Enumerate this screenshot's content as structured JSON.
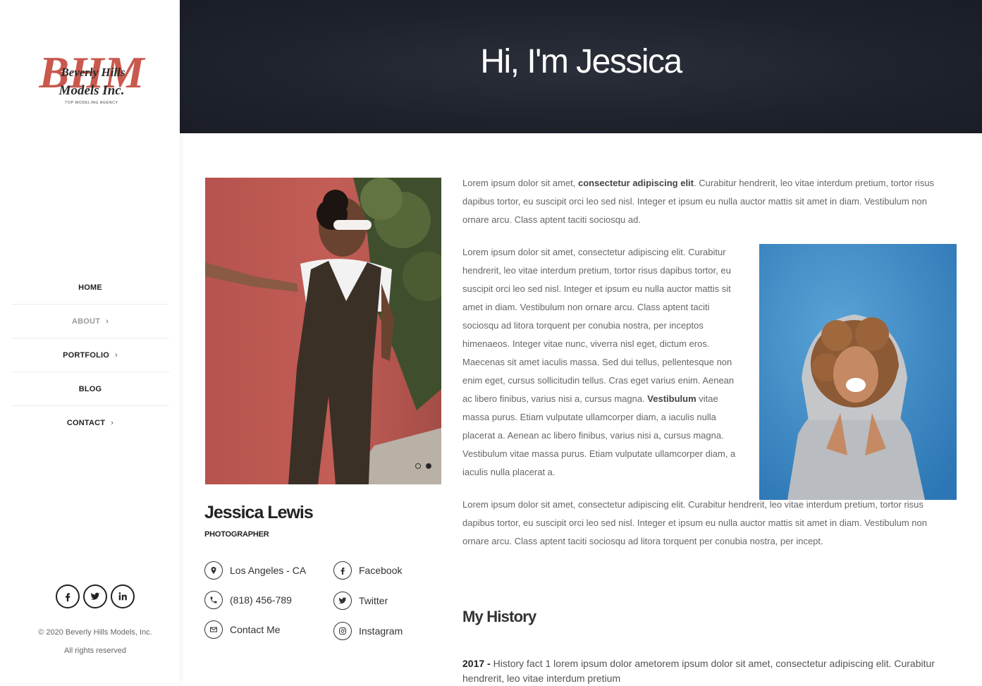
{
  "brand": {
    "logo_letters": "BHM",
    "logo_line1": "Beverly Hills",
    "logo_line2": "Models Inc.",
    "tagline": "TOP MODELING AGENCY",
    "accent": "#c9584d"
  },
  "nav": {
    "home": "HOME",
    "about": "ABOUT",
    "portfolio": "PORTFOLIO",
    "blog": "BLOG",
    "contact": "CONTACT"
  },
  "social_icons": [
    "facebook-icon",
    "twitter-icon",
    "linkedin-icon"
  ],
  "footer": {
    "copyright": "© 2020 Beverly Hills Models, Inc.",
    "rights": "All rights reserved"
  },
  "hero": {
    "title": "Hi, I'm Jessica"
  },
  "profile": {
    "name": "Jessica Lewis",
    "role": "PHOTOGRAPHER",
    "location": "Los Angeles - CA",
    "phone": "(818) 456-789",
    "contact": "Contact Me",
    "facebook": "Facebook",
    "twitter": "Twitter",
    "instagram": "Instagram"
  },
  "bio": {
    "p1_a": "Lorem ipsum dolor sit amet, ",
    "p1_bold": "consectetur adipiscing elit",
    "p1_b": ". Curabitur hendrerit, leo vitae interdum pretium, tortor risus dapibus tortor, eu suscipit orci leo sed nisl. Integer et ipsum eu nulla auctor mattis sit amet in diam. Vestibulum non ornare arcu. Class aptent taciti sociosqu ad.",
    "p2_a": "Lorem ipsum dolor sit amet, consectetur adipiscing elit. Curabitur hendrerit, leo vitae interdum pretium, tortor risus dapibus tortor, eu suscipit orci leo sed nisl. Integer et ipsum eu nulla auctor mattis sit amet in diam. Vestibulum non ornare arcu. Class aptent taciti sociosqu ad litora torquent per conubia nostra, per inceptos himenaeos. Integer vitae nunc, viverra nisl eget, dictum eros. Maecenas sit amet iaculis massa. Sed dui tellus, pellentesque non enim eget, cursus sollicitudin tellus. Cras eget varius enim. Aenean ac libero finibus, varius nisi a, cursus magna. ",
    "p2_bold": "Vestibulum",
    "p2_b": " vitae massa purus. Etiam vulputate ullamcorper diam, a iaculis nulla placerat a. Aenean ac libero finibus, varius nisi a, cursus magna. Vestibulum vitae massa purus. Etiam vulputate ullamcorper diam, a iaculis nulla placerat a.",
    "p3": "Lorem ipsum dolor sit amet, consectetur adipiscing elit. Curabitur hendrerit, leo vitae interdum pretium, tortor risus dapibus tortor, eu suscipit orci leo sed nisl. Integer et ipsum eu nulla auctor mattis sit amet in diam. Vestibulum non ornare arcu. Class aptent taciti sociosqu ad litora torquent per conubia nostra, per incept."
  },
  "history": {
    "heading": "My History",
    "year": "2017 -",
    "fact": " History fact 1 lorem ipsum dolor ametorem ipsum dolor sit amet, consectetur adipiscing elit. Curabitur hendrerit, leo vitae interdum pretium"
  }
}
